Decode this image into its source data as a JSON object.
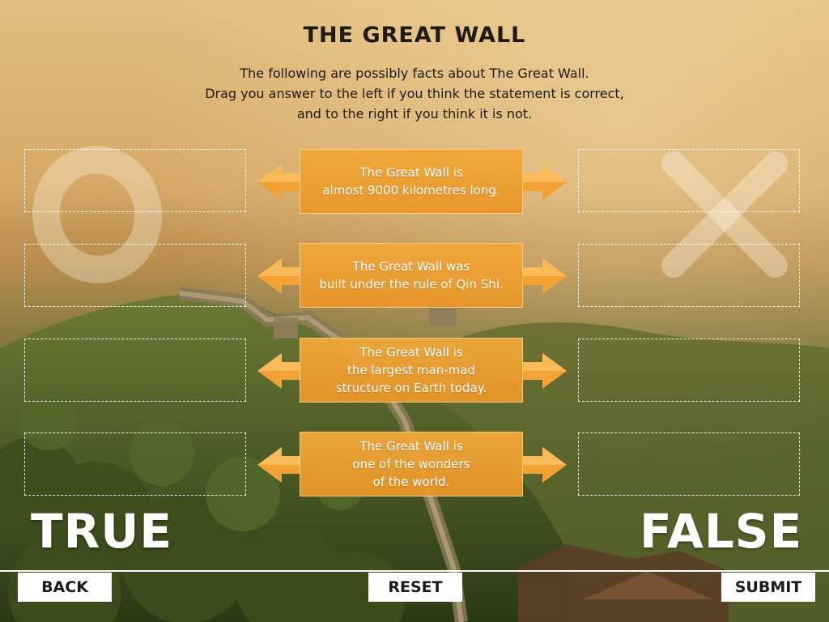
{
  "title": "THE GREAT WALL",
  "instructions": [
    "The following are possibly facts about The Great Wall.",
    "Drag you answer to the left if you think the statement is correct,",
    "and to the right if you think it is not."
  ],
  "statements": [
    "The Great Wall is\nalmost 9000 kilometres long.",
    "The Great Wall was\nbuilt under the rule of Qin Shi.",
    "The Great Wall is\nthe largest man-mad\nstructure on Earth today.",
    "The Great Wall is\none of the wonders\nof the world."
  ],
  "labels": {
    "true": "TRUE",
    "false": "FALSE"
  },
  "buttons": {
    "back": "BACK",
    "reset": "RESET",
    "submit": "SUBMIT"
  },
  "colors": {
    "card": "#f0a83a",
    "arrow": "#f2a134"
  }
}
